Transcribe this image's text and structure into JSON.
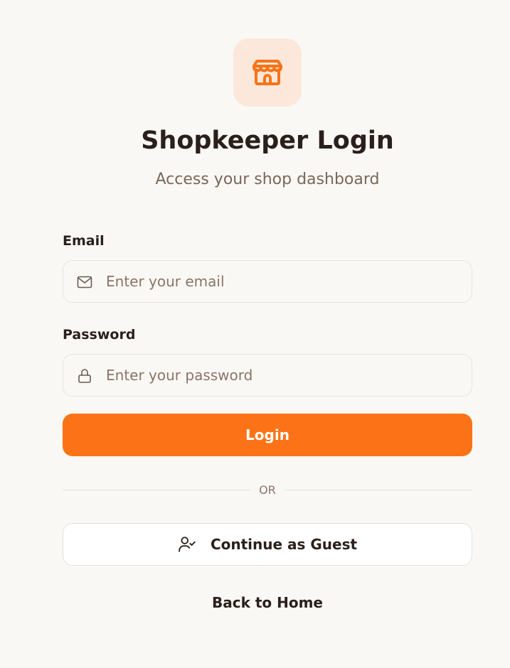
{
  "header": {
    "logo_icon": "store-icon",
    "title": "Shopkeeper Login",
    "subtitle": "Access your shop dashboard"
  },
  "form": {
    "email": {
      "label": "Email",
      "icon": "mail-icon",
      "value": "",
      "placeholder": "Enter your email"
    },
    "password": {
      "label": "Password",
      "icon": "lock-icon",
      "value": "",
      "placeholder": "Enter your password"
    },
    "login_label": "Login",
    "divider_label": "OR",
    "guest_label": "Continue as Guest",
    "guest_icon": "user-check-icon",
    "back_label": "Back to Home"
  },
  "colors": {
    "accent": "#fb7316",
    "logo_bg": "#fbe8db",
    "background": "#faf8f5",
    "text": "#2a1f1a",
    "muted": "#7b665a"
  }
}
